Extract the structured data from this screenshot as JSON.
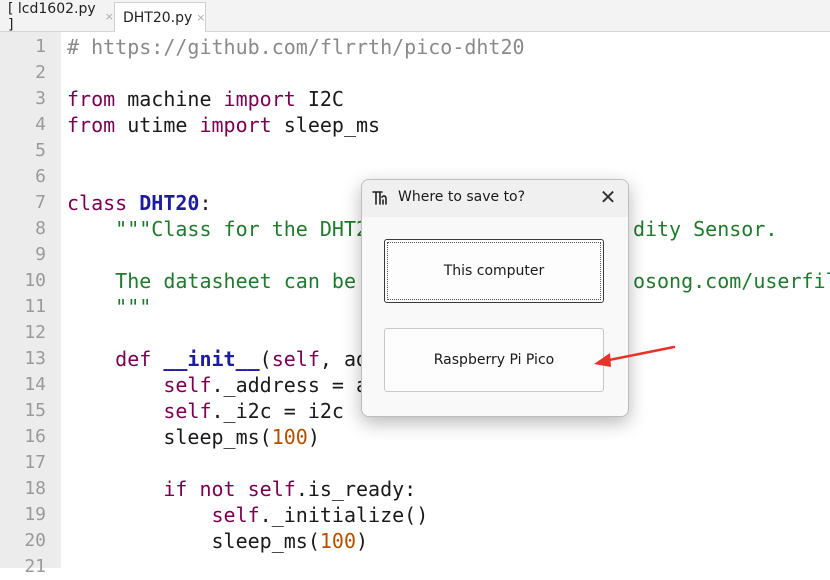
{
  "tabs": [
    {
      "label": "[ lcd1602.py ]",
      "close": "×"
    },
    {
      "label": "DHT20.py",
      "close": "×"
    }
  ],
  "editor": {
    "line_numbers": [
      "1",
      "2",
      "3",
      "4",
      "5",
      "6",
      "7",
      "8",
      "9",
      "10",
      "11",
      "12",
      "13",
      "14",
      "15",
      "16",
      "17",
      "18",
      "19",
      "20",
      "21"
    ],
    "lines": [
      [
        {
          "t": "# https://github.com/flrrth/pico-dht20",
          "c": "c"
        }
      ],
      [],
      [
        {
          "t": "from",
          "c": "k"
        },
        {
          "t": " machine ",
          "c": ""
        },
        {
          "t": "import",
          "c": "k"
        },
        {
          "t": " I2C",
          "c": ""
        }
      ],
      [
        {
          "t": "from",
          "c": "k"
        },
        {
          "t": " utime ",
          "c": ""
        },
        {
          "t": "import",
          "c": "k"
        },
        {
          "t": " sleep_ms",
          "c": ""
        }
      ],
      [],
      [],
      [
        {
          "t": "class",
          "c": "k"
        },
        {
          "t": " ",
          "c": ""
        },
        {
          "t": "DHT20",
          "c": "cls"
        },
        {
          "t": ":",
          "c": ""
        }
      ],
      [
        {
          "t": "    \"\"\"Class for the DHT2",
          "c": "s"
        },
        {
          "t": "                      ",
          "c": ""
        },
        {
          "t": "dity Sensor.",
          "c": "s"
        }
      ],
      [],
      [
        {
          "t": "    The datasheet can be ",
          "c": "s"
        },
        {
          "t": "                      ",
          "c": ""
        },
        {
          "t": "osong.com/userfile",
          "c": "s"
        }
      ],
      [
        {
          "t": "    \"\"\"",
          "c": "s"
        }
      ],
      [],
      [
        {
          "t": "    ",
          "c": ""
        },
        {
          "t": "def",
          "c": "k"
        },
        {
          "t": " ",
          "c": ""
        },
        {
          "t": "__init__",
          "c": "fn"
        },
        {
          "t": "(",
          "c": ""
        },
        {
          "t": "self",
          "c": "k"
        },
        {
          "t": ", ad",
          "c": ""
        }
      ],
      [
        {
          "t": "        ",
          "c": ""
        },
        {
          "t": "self",
          "c": "k"
        },
        {
          "t": "._address = a",
          "c": ""
        }
      ],
      [
        {
          "t": "        ",
          "c": ""
        },
        {
          "t": "self",
          "c": "k"
        },
        {
          "t": "._i2c = i2c",
          "c": ""
        }
      ],
      [
        {
          "t": "        sleep_ms(",
          "c": ""
        },
        {
          "t": "100",
          "c": "n"
        },
        {
          "t": ")",
          "c": ""
        }
      ],
      [],
      [
        {
          "t": "        ",
          "c": ""
        },
        {
          "t": "if",
          "c": "k"
        },
        {
          "t": " ",
          "c": ""
        },
        {
          "t": "not",
          "c": "k"
        },
        {
          "t": " ",
          "c": ""
        },
        {
          "t": "self",
          "c": "k"
        },
        {
          "t": ".is_ready:",
          "c": ""
        }
      ],
      [
        {
          "t": "            ",
          "c": ""
        },
        {
          "t": "self",
          "c": "k"
        },
        {
          "t": "._initialize()",
          "c": ""
        }
      ],
      [
        {
          "t": "            sleep_ms(",
          "c": ""
        },
        {
          "t": "100",
          "c": "n"
        },
        {
          "t": ")",
          "c": ""
        }
      ],
      []
    ]
  },
  "dialog": {
    "title": "Where to save to?",
    "close_glyph": "✕",
    "icon": "thonny-logo-icon",
    "options": [
      "This computer",
      "Raspberry Pi Pico"
    ]
  },
  "annotation": {
    "color": "#e8322a",
    "icon": "red-arrow-pointer"
  }
}
